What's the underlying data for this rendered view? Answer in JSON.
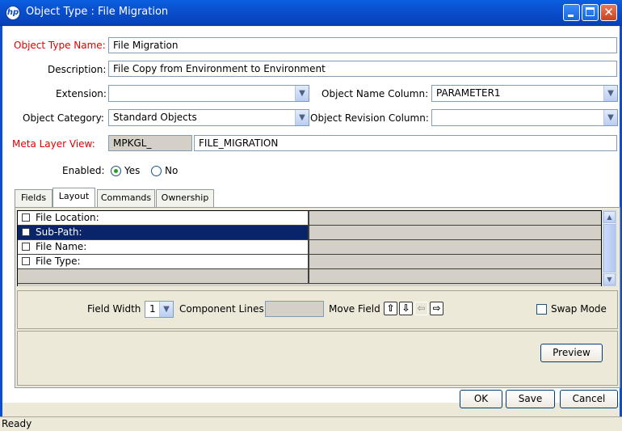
{
  "window": {
    "title": "Object Type : File Migration",
    "icon_name": "hp-logo-icon",
    "controls": [
      "minimize",
      "maximize",
      "close"
    ]
  },
  "form": {
    "object_type_name_label": "Object Type Name:",
    "object_type_name_value": "File Migration",
    "description_label": "Description:",
    "description_value": "File Copy from Environment to Environment",
    "extension_label": "Extension:",
    "extension_value": "",
    "object_name_column_label": "Object Name Column:",
    "object_name_column_value": "PARAMETER1",
    "object_category_label": "Object Category:",
    "object_category_value": "Standard Objects",
    "object_revision_column_label": "Object Revision Column:",
    "object_revision_column_value": "",
    "meta_layer_view_label": "Meta Layer View:",
    "meta_layer_prefix": "MPKGL_",
    "meta_layer_value": "FILE_MIGRATION",
    "enabled_label": "Enabled:",
    "enabled_yes": "Yes",
    "enabled_no": "No",
    "enabled_selected": "Yes"
  },
  "tabs": [
    {
      "label": "Fields",
      "active": false
    },
    {
      "label": "Layout",
      "active": true
    },
    {
      "label": "Commands",
      "active": false
    },
    {
      "label": "Ownership",
      "active": false
    }
  ],
  "layout_grid": {
    "rows": [
      {
        "label": "File Location:",
        "selected": false
      },
      {
        "label": "Sub-Path:",
        "selected": true
      },
      {
        "label": "File Name:",
        "selected": false
      },
      {
        "label": "File Type:",
        "selected": false
      }
    ]
  },
  "layout_controls": {
    "field_width_label": "Field Width",
    "field_width_value": "1",
    "component_lines_label": "Component Lines",
    "component_lines_value": "",
    "move_field_label": "Move Field",
    "swap_mode_label": "Swap Mode",
    "preview_label": "Preview"
  },
  "buttons": {
    "ok": "OK",
    "save": "Save",
    "cancel": "Cancel"
  },
  "status": {
    "text": "Ready"
  },
  "colors": {
    "required_label": "#e00000",
    "selection": "#0a246a",
    "title_bar": "#0a4fd0"
  }
}
